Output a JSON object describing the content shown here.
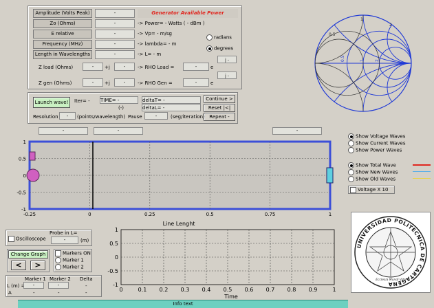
{
  "colors": {
    "panel": "#d4d0c8",
    "plot_frame": "#3c4fd8",
    "smith": "#1f39d6",
    "gen_power": "#e0271f",
    "info_bar": "#6cd0c0"
  },
  "generator": {
    "rows": [
      {
        "label": "Amplitude (Volts Peak)",
        "value": "-"
      },
      {
        "label": "Zo (Ohms)",
        "value": "-",
        "readout": "-> Power= - Watts  ( -  dBm )"
      },
      {
        "label": "E relative",
        "value": "-",
        "readout": "-> Vp= - m/sg"
      },
      {
        "label": "Frequency (MHz)",
        "value": "-",
        "readout": "-> lambda= - m"
      },
      {
        "label": "Length in Wavelengths",
        "value": "-",
        "readout": "-> L= - m"
      }
    ],
    "available_power_title": "Generator Available Power",
    "radians": "radians",
    "degrees": "degrees",
    "zload": {
      "label": "Z load (Ohms)",
      "re": "-",
      "plus_j": "+j",
      "im": "-",
      "readout": "-> RHO Load =",
      "rho_value": "-",
      "e": "e",
      "j_label": "j -"
    },
    "zgen": {
      "label": "Z gen (Ohms)",
      "re": "-",
      "plus_j": "+j",
      "im": "-",
      "readout": "-> RHO Gen =",
      "rho_value": "-",
      "e": "e",
      "j_label": "j -"
    }
  },
  "controls": {
    "launch": "Launch wave!",
    "iter": "Iter= -",
    "time": "TIME= -",
    "time_sub": "(-)",
    "deltaT": "deltaT= -",
    "deltaL": "deltaL= -",
    "continue": "Continue >",
    "reset": "Reset |<|",
    "repeat": "Repeat -",
    "resolution": "Resolution",
    "res_value": "-",
    "points_per_wl": "(points/wavelength)",
    "pause": "Pause",
    "pause_value": "-",
    "seg_iter": "(seg/iteration)"
  },
  "smith": {
    "labels": [
      "0.5",
      "1",
      "2",
      "0.5",
      "1",
      "2"
    ]
  },
  "top_fields": [
    "-",
    "-",
    "-"
  ],
  "wave_plot": {
    "title": "",
    "xlabel": "Line Lenght",
    "xticks": [
      "-0.25",
      "0",
      "0.25",
      "0.5",
      "0.75",
      "1"
    ],
    "yticks": [
      "1",
      "0.5",
      "0",
      "-0.5",
      "-1"
    ]
  },
  "wave_options": [
    "Show Voltage Waves",
    "Show Current Waves",
    "Show Power Waves"
  ],
  "wave_selected": 0,
  "display_options": [
    {
      "label": "Show Total Wave",
      "color": "#e0271f"
    },
    {
      "label": "Show New Waves",
      "color": "#5ab0e8"
    },
    {
      "label": "Show Old Waves",
      "color": "#e8d24a"
    }
  ],
  "display_selected": 0,
  "voltage_x10": "Voltage X 10",
  "oscilloscope": {
    "check": "Oscilloscope",
    "probe": "Probe in L=",
    "value": "-",
    "unit": "(m)"
  },
  "change_graph": {
    "label": "Change Graph",
    "prev": "<",
    "next": ">"
  },
  "markers": [
    "Markers ON",
    "Marker 1",
    "Marker 2"
  ],
  "marker_table": {
    "h1": "Marker 1",
    "h2": "Marker 2",
    "h3": "Delta",
    "r1": "L (m) =",
    "r2": "A",
    "v": "-"
  },
  "time_plot": {
    "xlabel": "Time",
    "xticks": [
      "0",
      "0.1",
      "0.2",
      "0.3",
      "0.4",
      "0.5",
      "0.6",
      "0.7",
      "0.8",
      "0.9",
      "1"
    ],
    "yticks": [
      "1",
      "0.5",
      "0",
      "-0.5",
      "-1"
    ]
  },
  "logo": {
    "text": "UNIVERSIDAD POLITECNICA DE CARTAGENA",
    "motto": "Ecclesia Mundi Vita"
  },
  "info_text": "Info text"
}
